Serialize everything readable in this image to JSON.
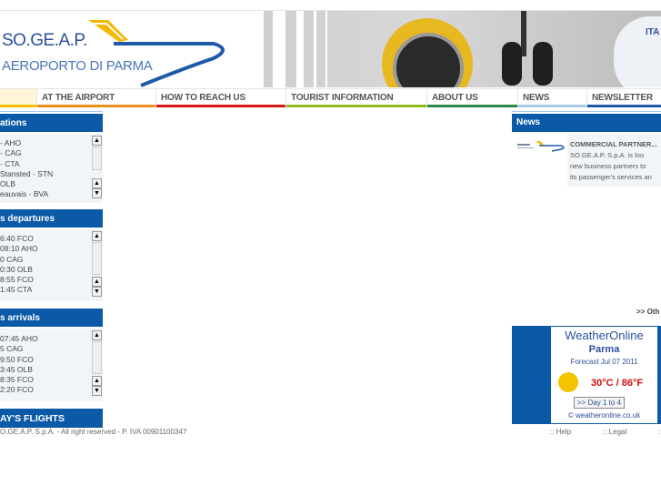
{
  "header": {
    "logo_title": "SO.GE.A.P.",
    "logo_subtitle": "AEROPORTO DI PARMA",
    "photo_text": "ITA"
  },
  "nav": {
    "items": [
      {
        "label": "",
        "color": "#f2c200"
      },
      {
        "label": "AT THE AIRPORT",
        "color": "#e8901e"
      },
      {
        "label": "HOW TO REACH US",
        "color": "#d81818"
      },
      {
        "label": "TOURIST INFORMATION",
        "color": "#8cbb1a"
      },
      {
        "label": "ABOUT US",
        "color": "#2a8a4a"
      },
      {
        "label": "NEWS",
        "color": "#a8cce8"
      },
      {
        "label": "NEWSLETTER",
        "color": "#1a58a8"
      }
    ]
  },
  "destinations": {
    "title": "ations",
    "items": [
      "- AHO",
      "- CAG",
      "- CTA",
      "Stansted - STN",
      "OLB",
      "eauvais - BVA"
    ]
  },
  "departures": {
    "title": "s departures",
    "items": [
      "6:40 FCO",
      "08:10 AHO",
      "0 CAG",
      "0:30 OLB",
      "8:55 FCO",
      "1:45 CTA"
    ]
  },
  "arrivals": {
    "title": "s arrivals",
    "items": [
      "07:45 AHO",
      "5 CAG",
      "9:50 FCO",
      "3:45 OLB",
      "8:35 FCO",
      "2:20 FCO"
    ]
  },
  "todays_flights": {
    "label": "AY'S FLIGHTS"
  },
  "copyright": "O.GE.A.P. S.p.A. - All right reserved - P. IVA 00901100347",
  "news": {
    "title": "News",
    "item_title": "COMMERCIAL PARTNER...",
    "item_lines": [
      "SO.GE.A.P.  S.p.A.  is  loo",
      "new business partners to",
      "its passenger's services an"
    ],
    "others_link": ">> Oth"
  },
  "weather": {
    "brand": "WeatherOnline",
    "city": "Parma",
    "forecast": "Forecast Jul 07 2011",
    "temperature": "30°C / 86°F",
    "button": ">> Day 1 to 4",
    "copyright": "© weatheronline.co.uk"
  },
  "footer": {
    "links": [
      ":: Help",
      ":: Legal",
      ":"
    ]
  },
  "scroll": {
    "up": "▲",
    "down": "▼"
  }
}
